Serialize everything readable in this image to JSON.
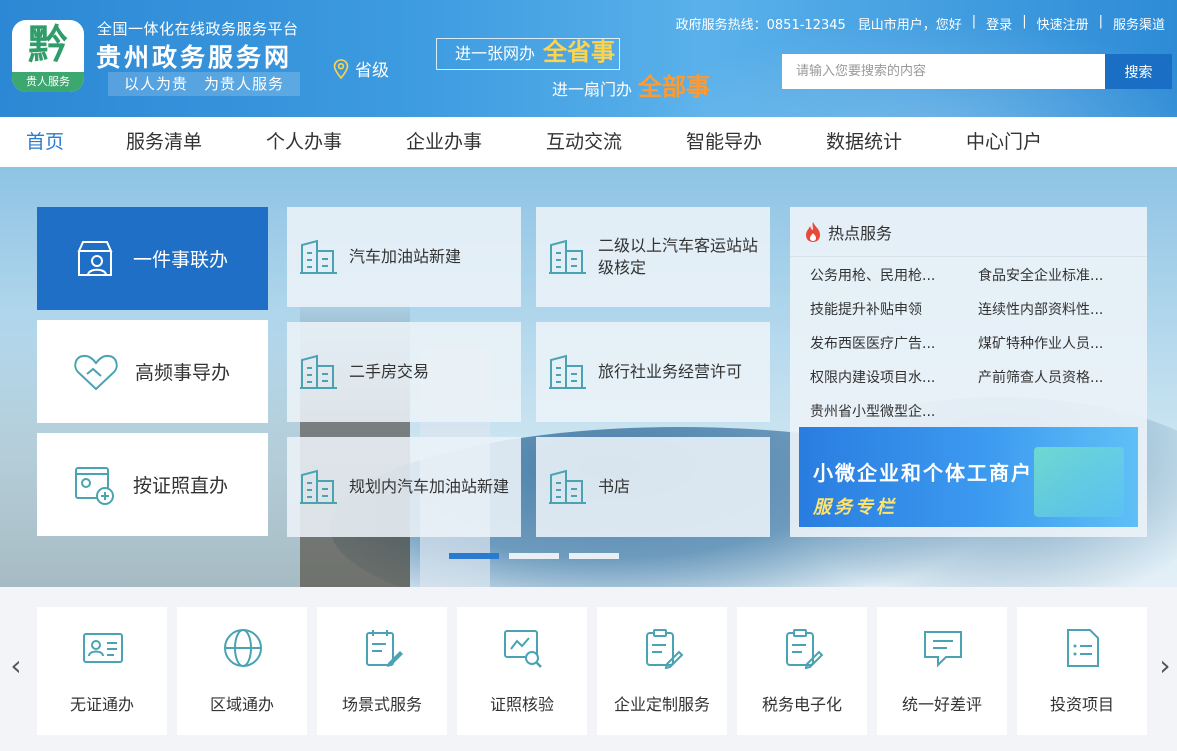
{
  "header": {
    "logo_glyph": "黔",
    "logo_tag": "贵人服务",
    "subtitle": "全国一体化在线政务服务平台",
    "title": "贵州政务服务网",
    "slogan": "以人为贵　为贵人服务",
    "region": "省级",
    "banner": {
      "line1_prefix": "进一张网办",
      "line1_emph": "全省事",
      "line2_prefix": "进一扇门办",
      "line2_emph": "全部事"
    },
    "hotline": "政府服务热线：0851-12345",
    "user_greeting": "昆山市用户，您好",
    "login": "登录",
    "register": "快速注册",
    "channel": "服务渠道",
    "search": {
      "placeholder": "请输入您要搜索的内容",
      "button": "搜索"
    }
  },
  "nav": {
    "items": [
      "首页",
      "服务清单",
      "个人办事",
      "企业办事",
      "互动交流",
      "智能导办",
      "数据统计",
      "中心门户"
    ],
    "active_index": 0
  },
  "hero": {
    "big_tiles": [
      "一件事联办",
      "高频事导办",
      "按证照直办"
    ],
    "small_tiles": [
      "汽车加油站新建",
      "二级以上汽车客运站站级核定",
      "二手房交易",
      "旅行社业务经营许可",
      "规划内汽车加油站新建",
      "书店"
    ],
    "hot": {
      "title": "热点服务",
      "items": [
        "公务用枪、民用枪...",
        "食品安全企业标准...",
        "技能提升补贴申领",
        "连续性内部资料性...",
        "发布西医医疗广告...",
        "煤矿特种作业人员...",
        "权限内建设项目水...",
        "产前筛查人员资格...",
        "贵州省小型微型企..."
      ],
      "banner_line1": "小微企业和个体工商户",
      "banner_line2": "服务专栏"
    },
    "carousel_active": 0,
    "carousel_count": 3
  },
  "services": [
    "无证通办",
    "区域通办",
    "场景式服务",
    "证照核验",
    "企业定制服务",
    "税务电子化",
    "统一好差评",
    "投资项目"
  ],
  "colors": {
    "primary": "#1f6fc6",
    "accent_icon": "#4aa3b3",
    "nav_active": "#2a7bd0"
  }
}
